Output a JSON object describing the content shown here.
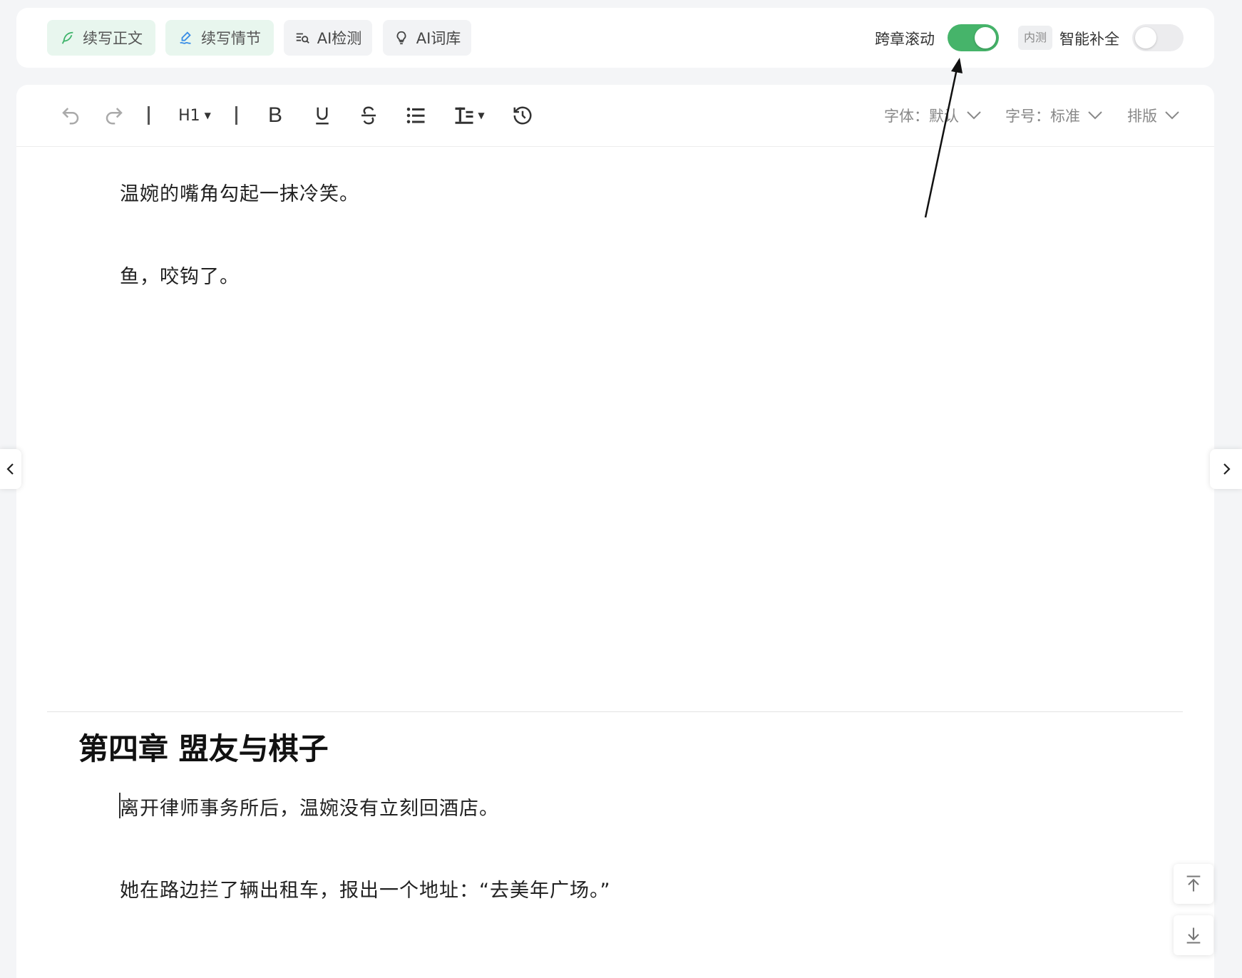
{
  "top_actions": {
    "continue_text": "续写正文",
    "continue_plot": "续写情节",
    "ai_detect": "AI检测",
    "ai_lexicon": "AI词库"
  },
  "cross_chapter_scroll": {
    "label": "跨章滚动",
    "on": true
  },
  "smart_complete": {
    "badge": "内测",
    "label": "智能补全",
    "on": false
  },
  "toolbar": {
    "heading": "H1",
    "bold": "B",
    "font": "字体：默认",
    "size": "字号：标准",
    "layout": "排版"
  },
  "content": {
    "paragraphs_prev": [
      "温婉的嘴角勾起一抹冷笑。",
      "鱼，咬钩了。"
    ],
    "chapter_title": "第四章 盟友与棋子",
    "paragraphs_next": [
      "离开律师事务所后，温婉没有立刻回酒店。",
      "她在路边拦了辆出租车，报出一个地址：“去美年广场。”"
    ]
  },
  "colors": {
    "accent_green": "#46b46a",
    "toggle_off": "#ececee",
    "text": "#222222"
  }
}
